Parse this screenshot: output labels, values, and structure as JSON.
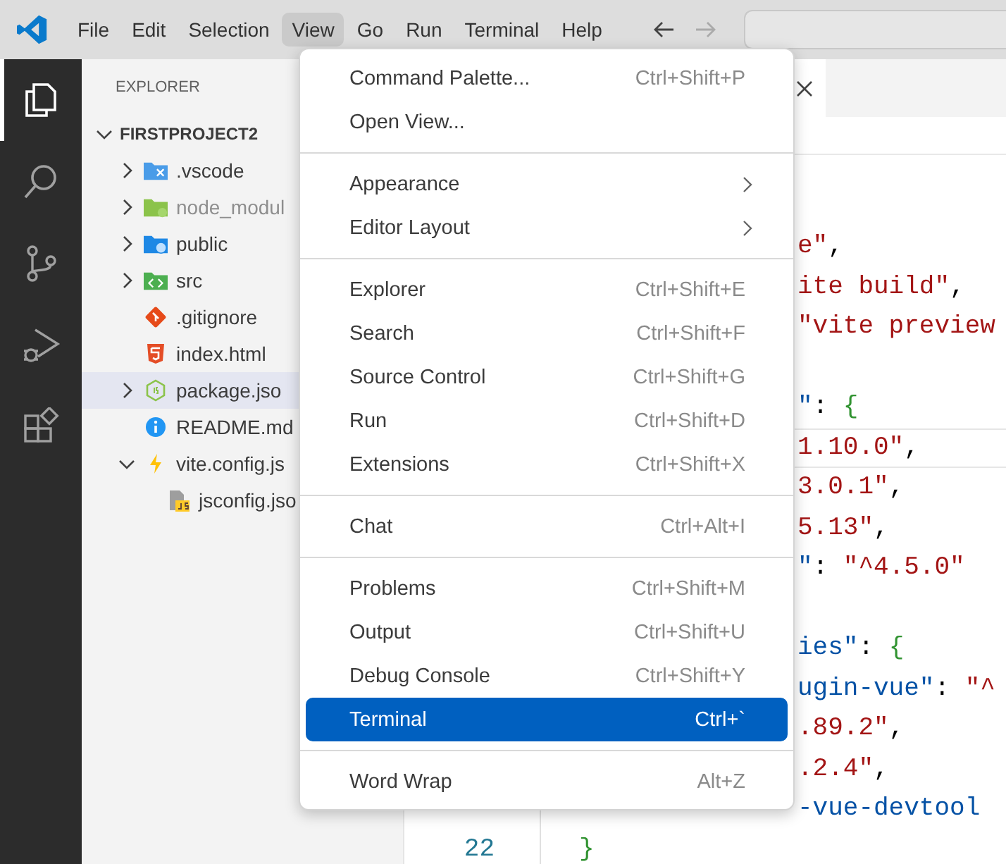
{
  "title_bar": {
    "menus": [
      {
        "label": "File",
        "selected": false
      },
      {
        "label": "Edit",
        "selected": false
      },
      {
        "label": "Selection",
        "selected": false
      },
      {
        "label": "View",
        "selected": true
      },
      {
        "label": "Go",
        "selected": false
      },
      {
        "label": "Run",
        "selected": false
      },
      {
        "label": "Terminal",
        "selected": false
      },
      {
        "label": "Help",
        "selected": false
      }
    ]
  },
  "activity_bar": [
    {
      "kind": "explorer",
      "selected": true
    },
    {
      "kind": "search",
      "selected": false
    },
    {
      "kind": "source-control",
      "selected": false
    },
    {
      "kind": "run-debug",
      "selected": false
    },
    {
      "kind": "extensions",
      "selected": false
    }
  ],
  "explorer": {
    "title": "EXPLORER",
    "root": {
      "label": "FIRSTPROJECT2",
      "expanded": true
    },
    "items": [
      {
        "label": ".vscode",
        "kind": "vscode-folder",
        "expanded": false,
        "dimmed": false,
        "hovered": false
      },
      {
        "label": "node_modul",
        "kind": "node-folder",
        "expanded": false,
        "dimmed": true,
        "hovered": false
      },
      {
        "label": "public",
        "kind": "public-folder",
        "expanded": false,
        "dimmed": false,
        "hovered": false
      },
      {
        "label": "src",
        "kind": "src-folder",
        "expanded": false,
        "dimmed": false,
        "hovered": false
      },
      {
        "label": ".gitignore",
        "kind": "git",
        "dimmed": false,
        "hovered": false
      },
      {
        "label": "index.html",
        "kind": "html",
        "dimmed": false,
        "hovered": false
      },
      {
        "label": "package.jso",
        "kind": "node-json",
        "expanded": false,
        "dimmed": false,
        "hovered": true
      },
      {
        "label": "README.md",
        "kind": "info",
        "dimmed": false,
        "hovered": false
      },
      {
        "label": "vite.config.js",
        "kind": "vite",
        "expanded": true,
        "dimmed": false,
        "hovered": false,
        "children": [
          {
            "label": "jsconfig.jso",
            "kind": "js-file",
            "dimmed": false,
            "hovered": false
          }
        ]
      }
    ]
  },
  "editor": {
    "lines": [
      {
        "kind": "clipped",
        "current": false,
        "tokens": [
          {
            "text": "e\"",
            "kind": "string"
          },
          {
            "text": ",",
            "kind": "punct"
          }
        ]
      },
      {
        "kind": "clipped",
        "current": false,
        "tokens": [
          {
            "text": "ite build\"",
            "kind": "string"
          },
          {
            "text": ",",
            "kind": "punct"
          }
        ]
      },
      {
        "kind": "clipped",
        "current": false,
        "tokens": [
          {
            "text": "\"vite preview",
            "kind": "string"
          }
        ]
      },
      {
        "kind": "clipped",
        "current": false
      },
      {
        "kind": "clipped",
        "current": false,
        "tokens": [
          {
            "text": "\"",
            "kind": "key"
          },
          {
            "text": ": ",
            "kind": "punct"
          },
          {
            "text": "{",
            "kind": "bracket"
          }
        ]
      },
      {
        "kind": "clipped",
        "current": true,
        "tokens": [
          {
            "text": "1.10.0\"",
            "kind": "string"
          },
          {
            "text": ",",
            "kind": "punct"
          }
        ]
      },
      {
        "kind": "clipped",
        "current": false,
        "tokens": [
          {
            "text": "3.0.1\"",
            "kind": "string"
          },
          {
            "text": ",",
            "kind": "punct"
          }
        ]
      },
      {
        "kind": "clipped",
        "current": false,
        "tokens": [
          {
            "text": "5.13\"",
            "kind": "string"
          },
          {
            "text": ",",
            "kind": "punct"
          }
        ]
      },
      {
        "kind": "clipped",
        "current": false,
        "tokens": [
          {
            "text": "\"",
            "kind": "key"
          },
          {
            "text": ": ",
            "kind": "punct"
          },
          {
            "text": "\"^4.5.0\"",
            "kind": "string"
          }
        ]
      },
      {
        "kind": "clipped",
        "current": false
      },
      {
        "kind": "clipped",
        "current": false,
        "tokens": [
          {
            "text": "ies\"",
            "kind": "key"
          },
          {
            "text": ": ",
            "kind": "punct"
          },
          {
            "text": "{",
            "kind": "bracket"
          }
        ]
      },
      {
        "kind": "clipped",
        "current": false,
        "tokens": [
          {
            "text": "ugin-vue\"",
            "kind": "key"
          },
          {
            "text": ": ",
            "kind": "punct"
          },
          {
            "text": "\"^",
            "kind": "string"
          }
        ]
      },
      {
        "kind": "clipped",
        "current": false,
        "tokens": [
          {
            "text": ".89.2\"",
            "kind": "string"
          },
          {
            "text": ",",
            "kind": "punct"
          }
        ]
      },
      {
        "kind": "clipped",
        "current": false,
        "tokens": [
          {
            "text": ".2.4\"",
            "kind": "string"
          },
          {
            "text": ",",
            "kind": "punct"
          }
        ]
      },
      {
        "kind": "clipped",
        "current": false,
        "tokens": [
          {
            "text": "-vue-devtool",
            "kind": "key"
          }
        ]
      },
      {
        "kind": "top",
        "number": "22",
        "current": false,
        "tokens": [
          {
            "text": "}",
            "kind": "bracket"
          }
        ]
      }
    ]
  },
  "view_menu": {
    "groups": [
      [
        {
          "label": "Command Palette...",
          "shortcut": "Ctrl+Shift+P",
          "submenu": false,
          "selected": false
        },
        {
          "label": "Open View...",
          "submenu": false,
          "selected": false
        }
      ],
      [
        {
          "label": "Appearance",
          "submenu": true,
          "selected": false
        },
        {
          "label": "Editor Layout",
          "submenu": true,
          "selected": false
        }
      ],
      [
        {
          "label": "Explorer",
          "shortcut": "Ctrl+Shift+E",
          "submenu": false,
          "selected": false
        },
        {
          "label": "Search",
          "shortcut": "Ctrl+Shift+F",
          "submenu": false,
          "selected": false
        },
        {
          "label": "Source Control",
          "shortcut": "Ctrl+Shift+G",
          "submenu": false,
          "selected": false
        },
        {
          "label": "Run",
          "shortcut": "Ctrl+Shift+D",
          "submenu": false,
          "selected": false
        },
        {
          "label": "Extensions",
          "shortcut": "Ctrl+Shift+X",
          "submenu": false,
          "selected": false
        }
      ],
      [
        {
          "label": "Chat",
          "shortcut": "Ctrl+Alt+I",
          "submenu": false,
          "selected": false
        }
      ],
      [
        {
          "label": "Problems",
          "shortcut": "Ctrl+Shift+M",
          "submenu": false,
          "selected": false
        },
        {
          "label": "Output",
          "shortcut": "Ctrl+Shift+U",
          "submenu": false,
          "selected": false
        },
        {
          "label": "Debug Console",
          "shortcut": "Ctrl+Shift+Y",
          "submenu": false,
          "selected": false
        },
        {
          "label": "Terminal",
          "shortcut": "Ctrl+`",
          "submenu": false,
          "selected": true
        }
      ],
      [
        {
          "label": "Word Wrap",
          "shortcut": "Alt+Z",
          "submenu": false,
          "selected": false
        }
      ]
    ]
  }
}
